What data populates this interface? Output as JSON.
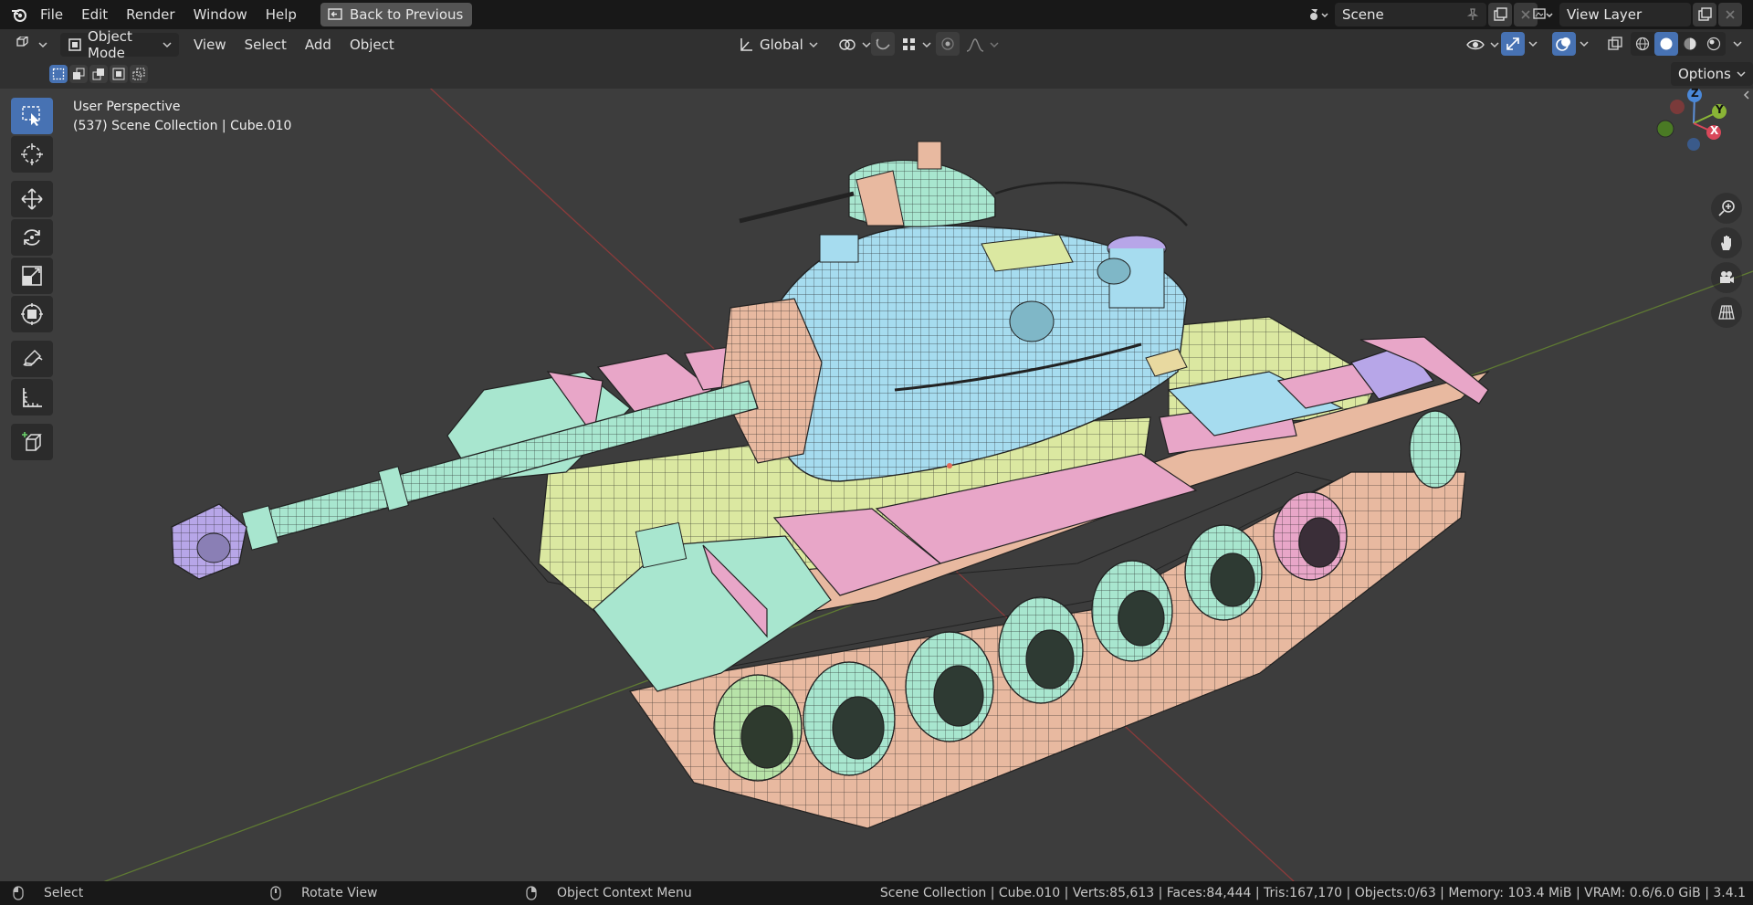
{
  "menu": {
    "file": "File",
    "edit": "Edit",
    "render": "Render",
    "window": "Window",
    "help": "Help",
    "back_to_previous": "Back to Previous"
  },
  "scene": {
    "name": "Scene"
  },
  "view_layer": {
    "name": "View Layer"
  },
  "header": {
    "mode": "Object Mode",
    "view": "View",
    "select": "Select",
    "add": "Add",
    "object": "Object",
    "orientation": "Global",
    "options": "Options"
  },
  "viewport": {
    "perspective": "User Perspective",
    "collection_info": "(537) Scene Collection | Cube.010",
    "gizmo": {
      "z": "Z",
      "y": "Y",
      "x": "X"
    }
  },
  "toolbar": {
    "tools": [
      "select-box",
      "cursor",
      "move",
      "rotate",
      "scale",
      "transform",
      "annotate",
      "measure",
      "add-cube"
    ]
  },
  "statusbar": {
    "select": "Select",
    "rotate_view": "Rotate View",
    "context_menu": "Object Context Menu",
    "stats": "Scene Collection | Cube.010 | Verts:85,613 | Faces:84,444 | Tris:167,170 | Objects:0/63 | Memory: 103.4 MiB | VRAM: 0.6/6.0 GiB | 3.4.1"
  },
  "colors": {
    "accent": "#4772b3",
    "viewport_bg": "#3d3d3d",
    "mint": "#a8e6cf",
    "blue": "#a6dcef",
    "yellow": "#dbe8a1",
    "pink": "#e8a6c8",
    "salmon": "#e8b9a0",
    "violet": "#b7a6e8"
  }
}
